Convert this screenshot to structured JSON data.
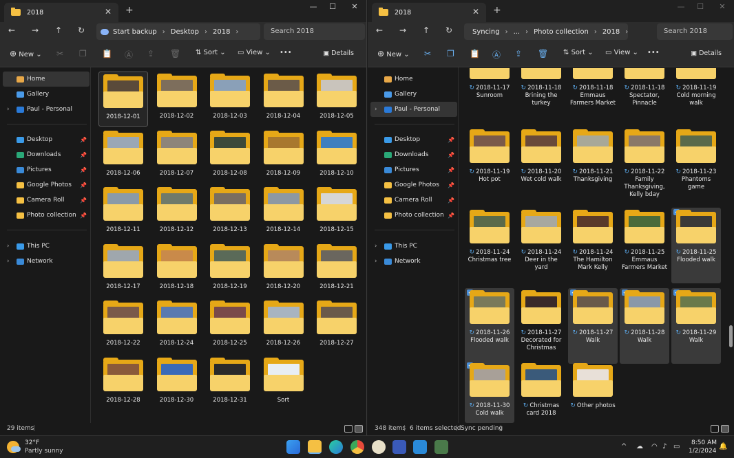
{
  "left": {
    "tab_title": "2018",
    "breadcrumbs": [
      "Start backup",
      "Desktop",
      "2018"
    ],
    "search_placeholder": "Search 2018",
    "toolbar": {
      "new": "New",
      "sort": "Sort",
      "view": "View",
      "more": "•••",
      "details": "Details"
    },
    "nav": {
      "home": "Home",
      "gallery": "Gallery",
      "personal": "Paul - Personal",
      "desktop": "Desktop",
      "downloads": "Downloads",
      "pictures": "Pictures",
      "google_photos": "Google Photos",
      "camera_roll": "Camera Roll",
      "photo_collection": "Photo collection",
      "this_pc": "This PC",
      "network": "Network"
    },
    "items": [
      {
        "name": "2018-12-01",
        "photo": "#5a4a3a"
      },
      {
        "name": "2018-12-02",
        "photo": "#7d6e5c"
      },
      {
        "name": "2018-12-03",
        "photo": "#8aa0b8"
      },
      {
        "name": "2018-12-04",
        "photo": "#6b5b48"
      },
      {
        "name": "2018-12-05",
        "photo": "#c9c4bc"
      },
      {
        "name": "2018-12-06",
        "photo": "#9aa7b5"
      },
      {
        "name": "2018-12-07",
        "photo": "#8d857a"
      },
      {
        "name": "2018-12-08",
        "photo": "#3d4a3a"
      },
      {
        "name": "2018-12-09",
        "photo": "#a8782e"
      },
      {
        "name": "2018-12-10",
        "photo": "#3f7fbf"
      },
      {
        "name": "2018-12-11",
        "photo": "#8a9aa8"
      },
      {
        "name": "2018-12-12",
        "photo": "#6f7a6a"
      },
      {
        "name": "2018-12-13",
        "photo": "#7a6e60"
      },
      {
        "name": "2018-12-14",
        "photo": "#8d98a2"
      },
      {
        "name": "2018-12-15",
        "photo": "#d6d6d6"
      },
      {
        "name": "2018-12-17",
        "photo": "#9fa7ad"
      },
      {
        "name": "2018-12-18",
        "photo": "#c98a4a"
      },
      {
        "name": "2018-12-19",
        "photo": "#5a6a58"
      },
      {
        "name": "2018-12-20",
        "photo": "#b88a5a"
      },
      {
        "name": "2018-12-21",
        "photo": "#6a665e"
      },
      {
        "name": "2018-12-22",
        "photo": "#7a5a4a"
      },
      {
        "name": "2018-12-24",
        "photo": "#5a7ab0"
      },
      {
        "name": "2018-12-25",
        "photo": "#7a4a4a"
      },
      {
        "name": "2018-12-26",
        "photo": "#a8b4c0"
      },
      {
        "name": "2018-12-27",
        "photo": "#6a5a4a"
      },
      {
        "name": "2018-12-28",
        "photo": "#8a5a3a"
      },
      {
        "name": "2018-12-30",
        "photo": "#3a6ab8"
      },
      {
        "name": "2018-12-31",
        "photo": "#2a2a2a"
      },
      {
        "name": "Sort",
        "photo": "#e8eef4"
      }
    ],
    "status": {
      "count": "29 items"
    }
  },
  "right": {
    "tab_title": "2018",
    "breadcrumbs": [
      "Syncing",
      "...",
      "Photo collection",
      "2018"
    ],
    "search_placeholder": "Search 2018",
    "toolbar": {
      "new": "New",
      "sort": "Sort",
      "view": "View",
      "more": "•••",
      "details": "Details"
    },
    "nav": {
      "home": "Home",
      "gallery": "Gallery",
      "personal": "Paul - Personal",
      "desktop": "Desktop",
      "downloads": "Downloads",
      "pictures": "Pictures",
      "google_photos": "Google Photos",
      "camera_roll": "Camera Roll",
      "photo_collection": "Photo collection",
      "this_pc": "This PC",
      "network": "Network"
    },
    "items": [
      {
        "name": "2018-11-17 Sunroom",
        "photo": "#8a6a4a",
        "sel": false
      },
      {
        "name": "2018-11-18 Brining the turkey",
        "photo": "#7a5a3a",
        "sel": false
      },
      {
        "name": "2018-11-18 Emmaus Farmers Market",
        "photo": "#8a7a5a",
        "sel": false
      },
      {
        "name": "2018-11-18 Spectator, Pinnacle",
        "photo": "#6a2a2a",
        "sel": false
      },
      {
        "name": "2018-11-19 Cold morning walk",
        "photo": "#9aa0a8",
        "sel": false
      },
      {
        "name": "2018-11-19 Hot pot",
        "photo": "#7a5a4a",
        "sel": false
      },
      {
        "name": "2018-11-20 Wet cold walk",
        "photo": "#6a4a3a",
        "sel": false
      },
      {
        "name": "2018-11-21 Thanksgiving",
        "photo": "#a8a898",
        "sel": false
      },
      {
        "name": "2018-11-22 Family Thanksgiving, Kelly bday",
        "photo": "#8a7868",
        "sel": false
      },
      {
        "name": "2018-11-23 Phantoms game",
        "photo": "#5a6a4a",
        "sel": false
      },
      {
        "name": "2018-11-24 Christmas tree",
        "photo": "#5a6a4a",
        "sel": false
      },
      {
        "name": "2018-11-24 Deer in the yard",
        "photo": "#a8a8a0",
        "sel": false
      },
      {
        "name": "2018-11-24 The Hamilton Mark Kelly",
        "photo": "#5a3a2a",
        "sel": false
      },
      {
        "name": "2018-11-25 Emmaus Farmers Market",
        "photo": "#4a6a3a",
        "sel": false
      },
      {
        "name": "2018-11-25 Flooded walk",
        "photo": "#3a3a38",
        "sel": true
      },
      {
        "name": "2018-11-26 Flooded walk",
        "photo": "#7a7a5a",
        "sel": true
      },
      {
        "name": "2018-11-27 Decorated for Christmas",
        "photo": "#3a2a2a",
        "sel": false
      },
      {
        "name": "2018-11-27 Walk",
        "photo": "#6a5a4a",
        "sel": true
      },
      {
        "name": "2018-11-28 Walk",
        "photo": "#8a98a8",
        "sel": true
      },
      {
        "name": "2018-11-29 Walk",
        "photo": "#6a7a4a",
        "sel": true
      },
      {
        "name": "2018-11-30 Cold walk",
        "photo": "#a8a098",
        "sel": true
      },
      {
        "name": "Christmas card 2018",
        "photo": "#3a5a7a",
        "sel": false
      },
      {
        "name": "Other photos",
        "photo": "#e8e0d8",
        "sel": false
      }
    ],
    "status": {
      "count": "348 items",
      "selected": "6 items selected",
      "sync": "Sync pending"
    }
  },
  "taskbar": {
    "temp": "32°F",
    "weather": "Partly sunny",
    "time": "8:50 AM",
    "date": "1/2/2024"
  }
}
